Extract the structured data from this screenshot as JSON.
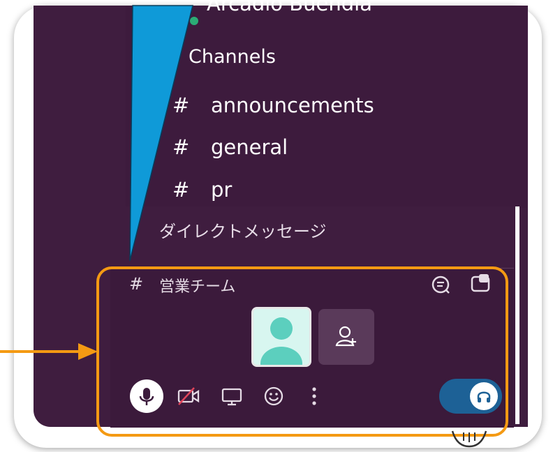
{
  "sidebar": {
    "partial_member_name": "Arcadio Buendía",
    "channels_title": "Channels",
    "channels": [
      {
        "hash": "#",
        "name": "announcements"
      },
      {
        "hash": "#",
        "name": "general"
      },
      {
        "hash": "#",
        "name": "pr"
      }
    ],
    "dm_section_title": "ダイレクトメッセージ"
  },
  "huddle": {
    "hash": "#",
    "channel_name": "営業チーム",
    "accent_color": "#f49a13",
    "toggle_color": "#1d6196",
    "icons": {
      "thread": "thread-icon",
      "popout": "popout-icon",
      "add_user": "add-user-icon",
      "mic": "microphone-icon",
      "camera": "camera-off-icon",
      "screen": "screen-share-icon",
      "emoji": "emoji-icon",
      "more": "more-vertical-icon",
      "headphones": "headphones-icon"
    }
  },
  "colors": {
    "sidebar_bg": "#3f1d3f",
    "pointer": "#0f9ad8",
    "arrow": "#f49a13",
    "avatar": "#5ccfbe"
  }
}
